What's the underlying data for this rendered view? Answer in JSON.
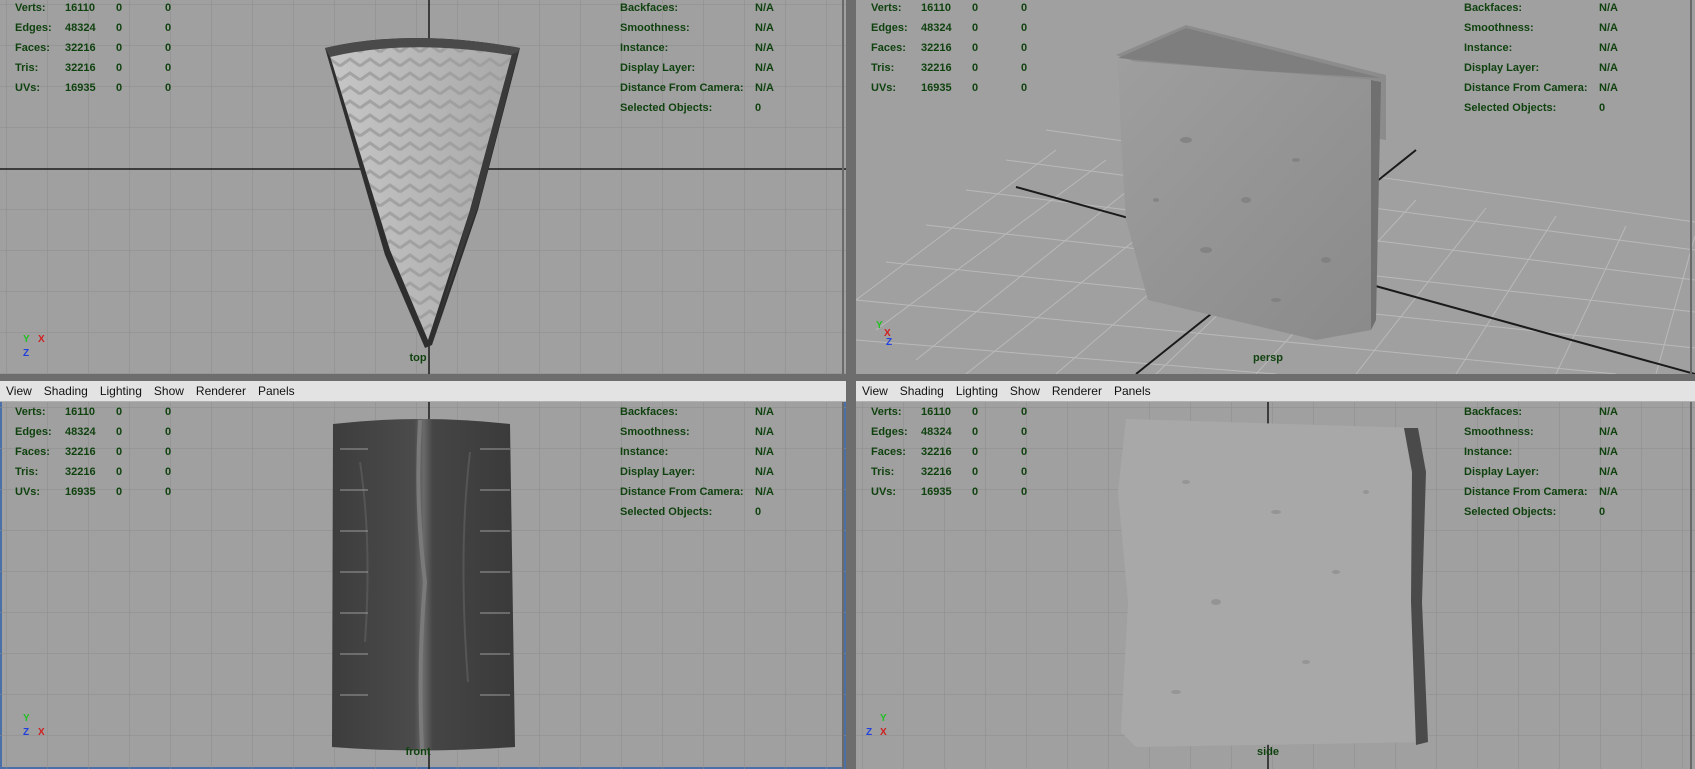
{
  "menu": [
    "View",
    "Shading",
    "Lighting",
    "Show",
    "Renderer",
    "Panels"
  ],
  "viewports": [
    {
      "camera": "top",
      "stats": [
        {
          "label": "Verts:",
          "v1": "16110",
          "v2": "0",
          "v3": "0"
        },
        {
          "label": "Edges:",
          "v1": "48324",
          "v2": "0",
          "v3": "0"
        },
        {
          "label": "Faces:",
          "v1": "32216",
          "v2": "0",
          "v3": "0"
        },
        {
          "label": "Tris:",
          "v1": "32216",
          "v2": "0",
          "v3": "0"
        },
        {
          "label": "UVs:",
          "v1": "16935",
          "v2": "0",
          "v3": "0"
        }
      ],
      "info": [
        {
          "label": "Backfaces:",
          "value": "N/A"
        },
        {
          "label": "Smoothness:",
          "value": "N/A"
        },
        {
          "label": "Instance:",
          "value": "N/A"
        },
        {
          "label": "Display Layer:",
          "value": "N/A"
        },
        {
          "label": "Distance From Camera:",
          "value": "N/A"
        },
        {
          "label": "Selected Objects:",
          "value": "0"
        }
      ],
      "axis": {
        "a": "Y",
        "b": "X",
        "c": "Z"
      }
    },
    {
      "camera": "persp",
      "stats": [
        {
          "label": "Verts:",
          "v1": "16110",
          "v2": "0",
          "v3": "0"
        },
        {
          "label": "Edges:",
          "v1": "48324",
          "v2": "0",
          "v3": "0"
        },
        {
          "label": "Faces:",
          "v1": "32216",
          "v2": "0",
          "v3": "0"
        },
        {
          "label": "Tris:",
          "v1": "32216",
          "v2": "0",
          "v3": "0"
        },
        {
          "label": "UVs:",
          "v1": "16935",
          "v2": "0",
          "v3": "0"
        }
      ],
      "info": [
        {
          "label": "Backfaces:",
          "value": "N/A"
        },
        {
          "label": "Smoothness:",
          "value": "N/A"
        },
        {
          "label": "Instance:",
          "value": "N/A"
        },
        {
          "label": "Display Layer:",
          "value": "N/A"
        },
        {
          "label": "Distance From Camera:",
          "value": "N/A"
        },
        {
          "label": "Selected Objects:",
          "value": "0"
        }
      ],
      "axis": {
        "a": "Y",
        "b": "X",
        "c": "Z"
      }
    },
    {
      "camera": "front",
      "stats": [
        {
          "label": "Verts:",
          "v1": "16110",
          "v2": "0",
          "v3": "0"
        },
        {
          "label": "Edges:",
          "v1": "48324",
          "v2": "0",
          "v3": "0"
        },
        {
          "label": "Faces:",
          "v1": "32216",
          "v2": "0",
          "v3": "0"
        },
        {
          "label": "Tris:",
          "v1": "32216",
          "v2": "0",
          "v3": "0"
        },
        {
          "label": "UVs:",
          "v1": "16935",
          "v2": "0",
          "v3": "0"
        }
      ],
      "info": [
        {
          "label": "Backfaces:",
          "value": "N/A"
        },
        {
          "label": "Smoothness:",
          "value": "N/A"
        },
        {
          "label": "Instance:",
          "value": "N/A"
        },
        {
          "label": "Display Layer:",
          "value": "N/A"
        },
        {
          "label": "Distance From Camera:",
          "value": "N/A"
        },
        {
          "label": "Selected Objects:",
          "value": "0"
        }
      ],
      "axis": {
        "a": "Y",
        "b": "X",
        "c": "Z"
      }
    },
    {
      "camera": "side",
      "stats": [
        {
          "label": "Verts:",
          "v1": "16110",
          "v2": "0",
          "v3": "0"
        },
        {
          "label": "Edges:",
          "v1": "48324",
          "v2": "0",
          "v3": "0"
        },
        {
          "label": "Faces:",
          "v1": "32216",
          "v2": "0",
          "v3": "0"
        },
        {
          "label": "Tris:",
          "v1": "32216",
          "v2": "0",
          "v3": "0"
        },
        {
          "label": "UVs:",
          "v1": "16935",
          "v2": "0",
          "v3": "0"
        }
      ],
      "info": [
        {
          "label": "Backfaces:",
          "value": "N/A"
        },
        {
          "label": "Smoothness:",
          "value": "N/A"
        },
        {
          "label": "Instance:",
          "value": "N/A"
        },
        {
          "label": "Display Layer:",
          "value": "N/A"
        },
        {
          "label": "Distance From Camera:",
          "value": "N/A"
        },
        {
          "label": "Selected Objects:",
          "value": "0"
        }
      ],
      "axis": {
        "a": "Y",
        "b": "X",
        "c": "Z"
      }
    }
  ]
}
